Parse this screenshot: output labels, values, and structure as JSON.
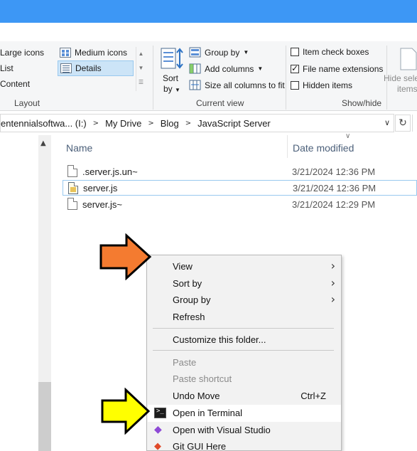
{
  "ribbon": {
    "layout": {
      "items": [
        "Large icons",
        "List",
        "Content",
        "Medium icons",
        "Details"
      ],
      "label": "Layout"
    },
    "current_view": {
      "sort_label": "Sort",
      "sort_by": "by",
      "group_by": "Group by",
      "add_columns": "Add columns",
      "size_columns": "Size all columns to fit",
      "label": "Current view"
    },
    "show_hide": {
      "item_check_boxes": "Item check boxes",
      "file_name_extensions": "File name extensions",
      "hidden_items": "Hidden items",
      "label": "Show/hide",
      "hide_selected_1": "Hide selec",
      "hide_selected_2": "items"
    },
    "checked": {
      "item_check_boxes": false,
      "file_name_extensions": true,
      "hidden_items": false
    }
  },
  "address": {
    "crumbs": [
      "entennialsoftwa... (I:)",
      "My Drive",
      "Blog",
      "JavaScript Server"
    ]
  },
  "columns": {
    "name": "Name",
    "date_modified": "Date modified"
  },
  "files": [
    {
      "name": ".server.js.un~",
      "date": "3/21/2024 12:36 PM"
    },
    {
      "name": "server.js",
      "date": "3/21/2024 12:36 PM"
    },
    {
      "name": "server.js~",
      "date": "3/21/2024 12:29 PM"
    }
  ],
  "context_menu": {
    "view": "View",
    "sort_by": "Sort by",
    "group_by": "Group by",
    "refresh": "Refresh",
    "customize": "Customize this folder...",
    "paste": "Paste",
    "paste_shortcut": "Paste shortcut",
    "undo_move": "Undo Move",
    "undo_shortcut": "Ctrl+Z",
    "open_terminal": "Open in Terminal",
    "open_vs": "Open with Visual Studio",
    "git_gui": "Git GUI Here"
  },
  "colors": {
    "titlebar": "#3d97f5",
    "arrow_orange": "#f47b30",
    "arrow_yellow": "#ffff00"
  }
}
